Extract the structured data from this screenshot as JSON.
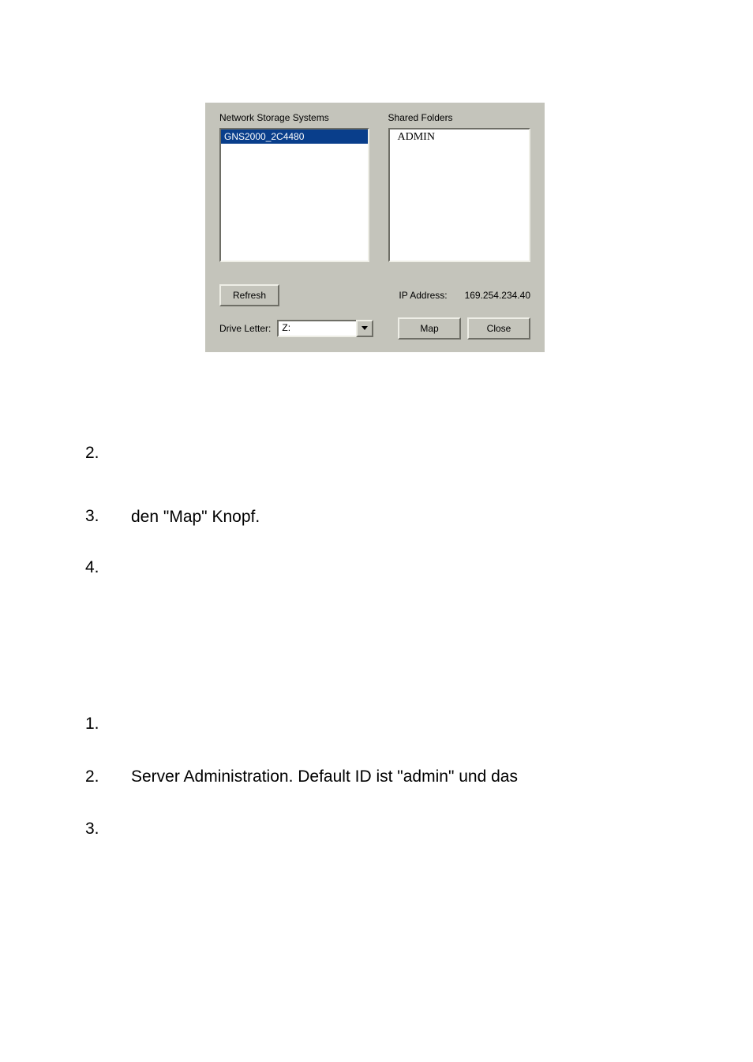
{
  "dialog": {
    "nss_label": "Network Storage Systems",
    "sf_label": "Shared Folders",
    "nss_selected": "GNS2000_2C4480",
    "sf_item": "ADMIN",
    "refresh": "Refresh",
    "ip_label": "IP Address:",
    "ip_value": "169.254.234.40",
    "drive_letter_label": "Drive Letter:",
    "drive_letter_value": "Z:",
    "map": "Map",
    "close": "Close"
  },
  "doc": {
    "items1": [
      {
        "num": "2.",
        "text": ""
      },
      {
        "num": "3.",
        "text": ""
      }
    ],
    "sub_after_3": "den \"Map\" Knopf.",
    "item4": {
      "num": "4.",
      "text": ""
    },
    "items2": [
      {
        "num": "1.",
        "text": ""
      },
      {
        "num": "2.",
        "text": "Server Administration. Default ID ist \"admin\" und das"
      },
      {
        "num": "3.",
        "text": ""
      }
    ]
  }
}
